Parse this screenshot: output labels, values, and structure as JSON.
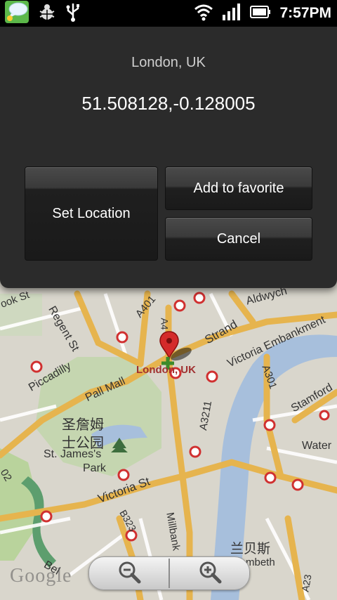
{
  "status_bar": {
    "time": "7:57PM",
    "icons_left": [
      "chat-icon",
      "android-debug-icon",
      "usb-icon"
    ],
    "icons_right": [
      "wifi-icon",
      "signal-icon",
      "battery-icon"
    ]
  },
  "dialog": {
    "title": "London, UK",
    "coordinates": "51.508128,-0.128005",
    "buttons": {
      "set_location": "Set Location",
      "add_favorite": "Add to favorite",
      "cancel": "Cancel"
    }
  },
  "map": {
    "pin_label": "London, UK",
    "labels": {
      "rook_st": "ook St",
      "regent_st": "Regent St",
      "a401": "A401",
      "aldwych": "Aldwych",
      "strand": "Strand",
      "victoria_embankment": "Victoria Embankment",
      "piccadilly": "Piccadilly",
      "pall_mall": "Pall Mall",
      "a301": "A301",
      "stamford": "Stamford",
      "a4": "A4",
      "a3211": "A3211",
      "chinese_park": "圣詹姆",
      "chinese_park2": "士公园",
      "st_james_park": "St. James's",
      "park": "Park",
      "water": "Water",
      "victoria_st": "Victoria St",
      "b323": "B323",
      "millbank": "Millbank",
      "chinese_lambeth": "兰贝斯",
      "lambeth": "mbeth",
      "a23": "A23",
      "a302": "02",
      "bel": "Bel"
    },
    "google_logo": "Google",
    "colors": {
      "road_major": "#f2c257",
      "road_minor": "#ffffff",
      "water": "#a5bfdd",
      "park": "#c2d9a5"
    }
  },
  "zoom": {
    "out_icon": "zoom-out-icon",
    "in_icon": "zoom-in-icon"
  }
}
